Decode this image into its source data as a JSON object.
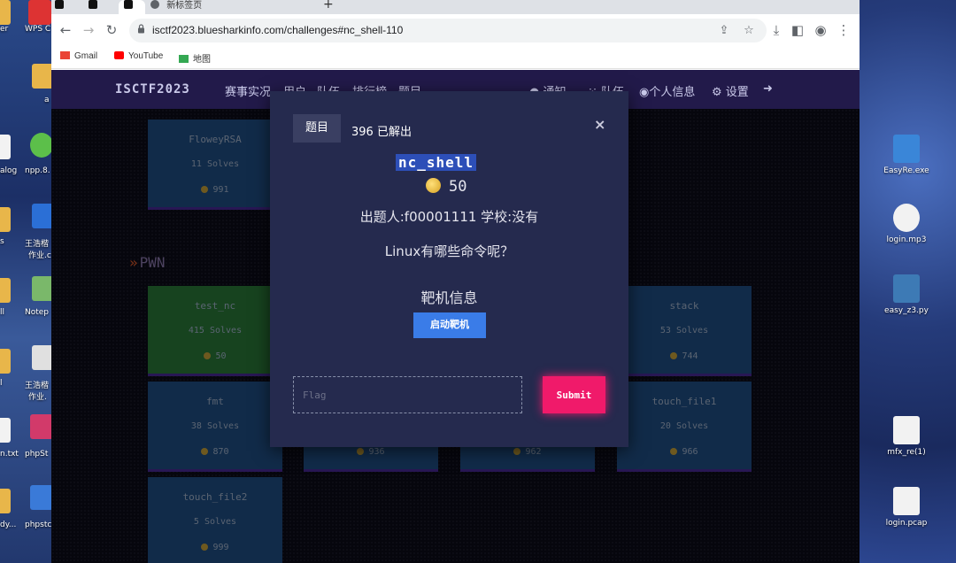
{
  "desktop": {
    "left_icons": [
      "er",
      "WPS C",
      "a",
      "alog",
      "npp.8.",
      "s",
      "王浩楷",
      "作业.c",
      "ll",
      "Notep",
      "l",
      "王浩楷",
      "作业.",
      "n.txt",
      "phpSt",
      "dy...",
      "phpstc"
    ],
    "right_icons": [
      {
        "label": "EasyRe.exe",
        "icon": "exe-icon",
        "color": "#3a86d8"
      },
      {
        "label": "login.mp3",
        "icon": "audio-file-icon",
        "color": "#f2f2f2"
      },
      {
        "label": "easy_z3.py",
        "icon": "python-file-icon",
        "color": "#3d7ab5"
      },
      {
        "label": "mfx_re(1)",
        "icon": "blank-file-icon",
        "color": "#f2f2f2"
      },
      {
        "label": "login.pcap",
        "icon": "blank-file-icon",
        "color": "#f2f2f2"
      }
    ]
  },
  "browser": {
    "tabs": [
      {
        "label": "",
        "icon": "tiktok-icon"
      },
      {
        "label": "",
        "icon": "tiktok-icon"
      },
      {
        "label": "",
        "icon": "tiktok-icon"
      },
      {
        "label": "新标签页",
        "icon": "globe-icon"
      }
    ],
    "new_tab": "+",
    "url": "isctf2023.bluesharkinfo.com/challenges#nc_shell-110",
    "bookmarks": [
      {
        "label": "Gmail",
        "icon": "gmail-icon"
      },
      {
        "label": "YouTube",
        "icon": "youtube-icon"
      },
      {
        "label": "地图",
        "icon": "maps-icon"
      }
    ]
  },
  "site": {
    "brand": "ISCTF2023",
    "nav": [
      "赛事实况",
      "用户",
      "队伍",
      "排行榜",
      "题目"
    ],
    "nav_right": {
      "notifications": "通知",
      "team": "队伍",
      "profile": "个人信息",
      "settings": "设置"
    },
    "section_title": "PWN",
    "cards": [
      {
        "name": "FloweyRSA",
        "solves": "11 Solves",
        "points": "991",
        "solved": false
      },
      {
        "name": "test_nc",
        "solves": "415 Solves",
        "points": "50",
        "solved": true
      },
      {
        "name": "stack",
        "solves": "53 Solves",
        "points": "744",
        "solved": false
      },
      {
        "name": "fmt",
        "solves": "38 Solves",
        "points": "870",
        "solved": false
      },
      {
        "name": "",
        "solves": "",
        "points": "936",
        "solved": false
      },
      {
        "name": "",
        "solves": "",
        "points": "962",
        "solved": false
      },
      {
        "name": "touch_file1",
        "solves": "20 Solves",
        "points": "966",
        "solved": false
      },
      {
        "name": "touch_file2",
        "solves": "5 Solves",
        "points": "999",
        "solved": false
      }
    ]
  },
  "modal": {
    "tab": "题目",
    "solved": "396 已解出",
    "close": "×",
    "name": "nc_shell",
    "value": "50",
    "author_line": "出题人:f00001111 学校:没有",
    "description": "Linux有哪些命令呢？",
    "target_heading": "靶机信息",
    "start_button": "启动靶机",
    "flag_placeholder": "Flag",
    "submit": "Submit",
    "colors": {
      "submit": "#f01a6a",
      "start": "#3a7ce8",
      "name_highlight": "#2d4fb8"
    }
  }
}
